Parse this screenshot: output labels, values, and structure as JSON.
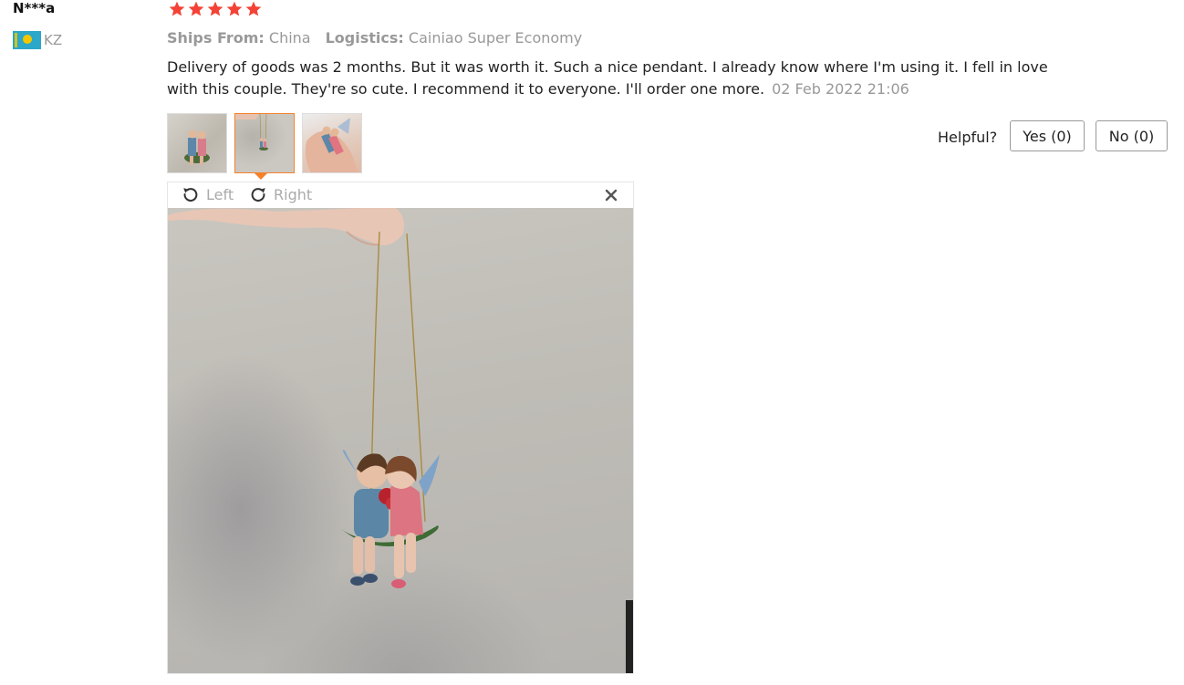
{
  "reviewer": {
    "name": "N***a",
    "country_code": "KZ",
    "flag_icon": "kazakhstan-flag-icon"
  },
  "rating": {
    "stars": 5,
    "max": 5,
    "color": "#f44336"
  },
  "meta": {
    "ships_from_label": "Ships From:",
    "ships_from_value": "China",
    "logistics_label": "Logistics:",
    "logistics_value": "Cainiao Super Economy"
  },
  "review": {
    "text": "Delivery of goods was 2 months. But it was worth it. Such a nice pendant. I already know where I'm using it. I fell in love with this couple. They're so cute. I recommend it to everyone. I'll order one more.",
    "date": "02 Feb 2022 21:06"
  },
  "helpful": {
    "label": "Helpful?",
    "yes_label": "Yes (0)",
    "no_label": "No (0)"
  },
  "viewer": {
    "rotate_left_label": "Left",
    "rotate_right_label": "Right",
    "accent_color": "#f5812b"
  }
}
